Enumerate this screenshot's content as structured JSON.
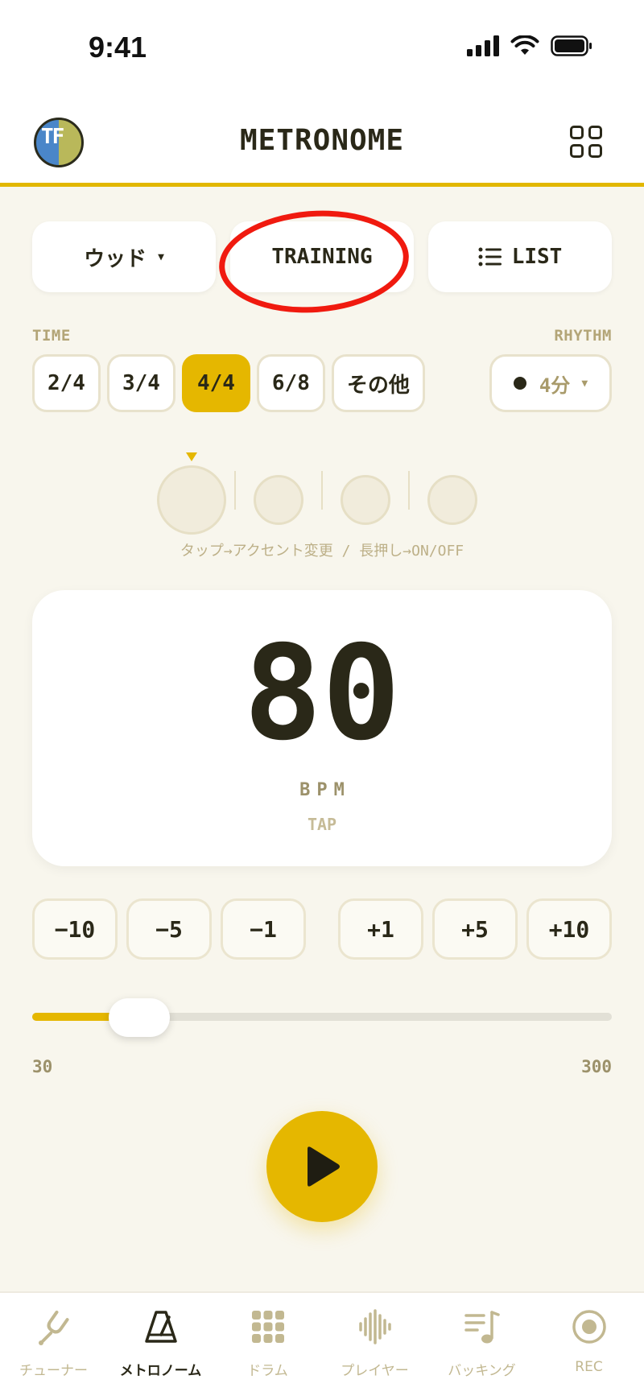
{
  "status_bar": {
    "time": "9:41"
  },
  "header": {
    "title": "METRONOME",
    "avatar_text": "TF"
  },
  "controls": {
    "sound_label": "ウッド",
    "training_label": "TRAINING",
    "list_label": "LIST"
  },
  "time_section": {
    "label": "TIME",
    "options": [
      "2/4",
      "3/4",
      "4/4",
      "6/8",
      "その他"
    ],
    "selected": "4/4"
  },
  "rhythm_section": {
    "label": "RHYTHM",
    "value": "4分"
  },
  "beats": {
    "count": 4,
    "current": 1,
    "hint": "タップ→アクセント変更 / 長押し→ON/OFF"
  },
  "tempo": {
    "bpm": "80",
    "unit": "BPM",
    "tap_label": "TAP",
    "steps": [
      "−10",
      "−5",
      "−1",
      "+1",
      "+5",
      "+10"
    ],
    "min": "30",
    "max": "300",
    "slider_fraction": 0.185
  },
  "tabbar": {
    "items": [
      {
        "label": "チューナー",
        "icon": "tuning-fork-icon"
      },
      {
        "label": "メトロノーム",
        "icon": "metronome-icon",
        "active": true
      },
      {
        "label": "ドラム",
        "icon": "drum-pad-grid-icon"
      },
      {
        "label": "プレイヤー",
        "icon": "waveform-icon"
      },
      {
        "label": "バッキング",
        "icon": "music-list-icon"
      },
      {
        "label": "REC",
        "icon": "record-icon"
      }
    ]
  },
  "colors": {
    "accent": "#e5b700",
    "background": "#f8f6ed",
    "text": "#2a2818",
    "annotation": "#f01a0f"
  }
}
